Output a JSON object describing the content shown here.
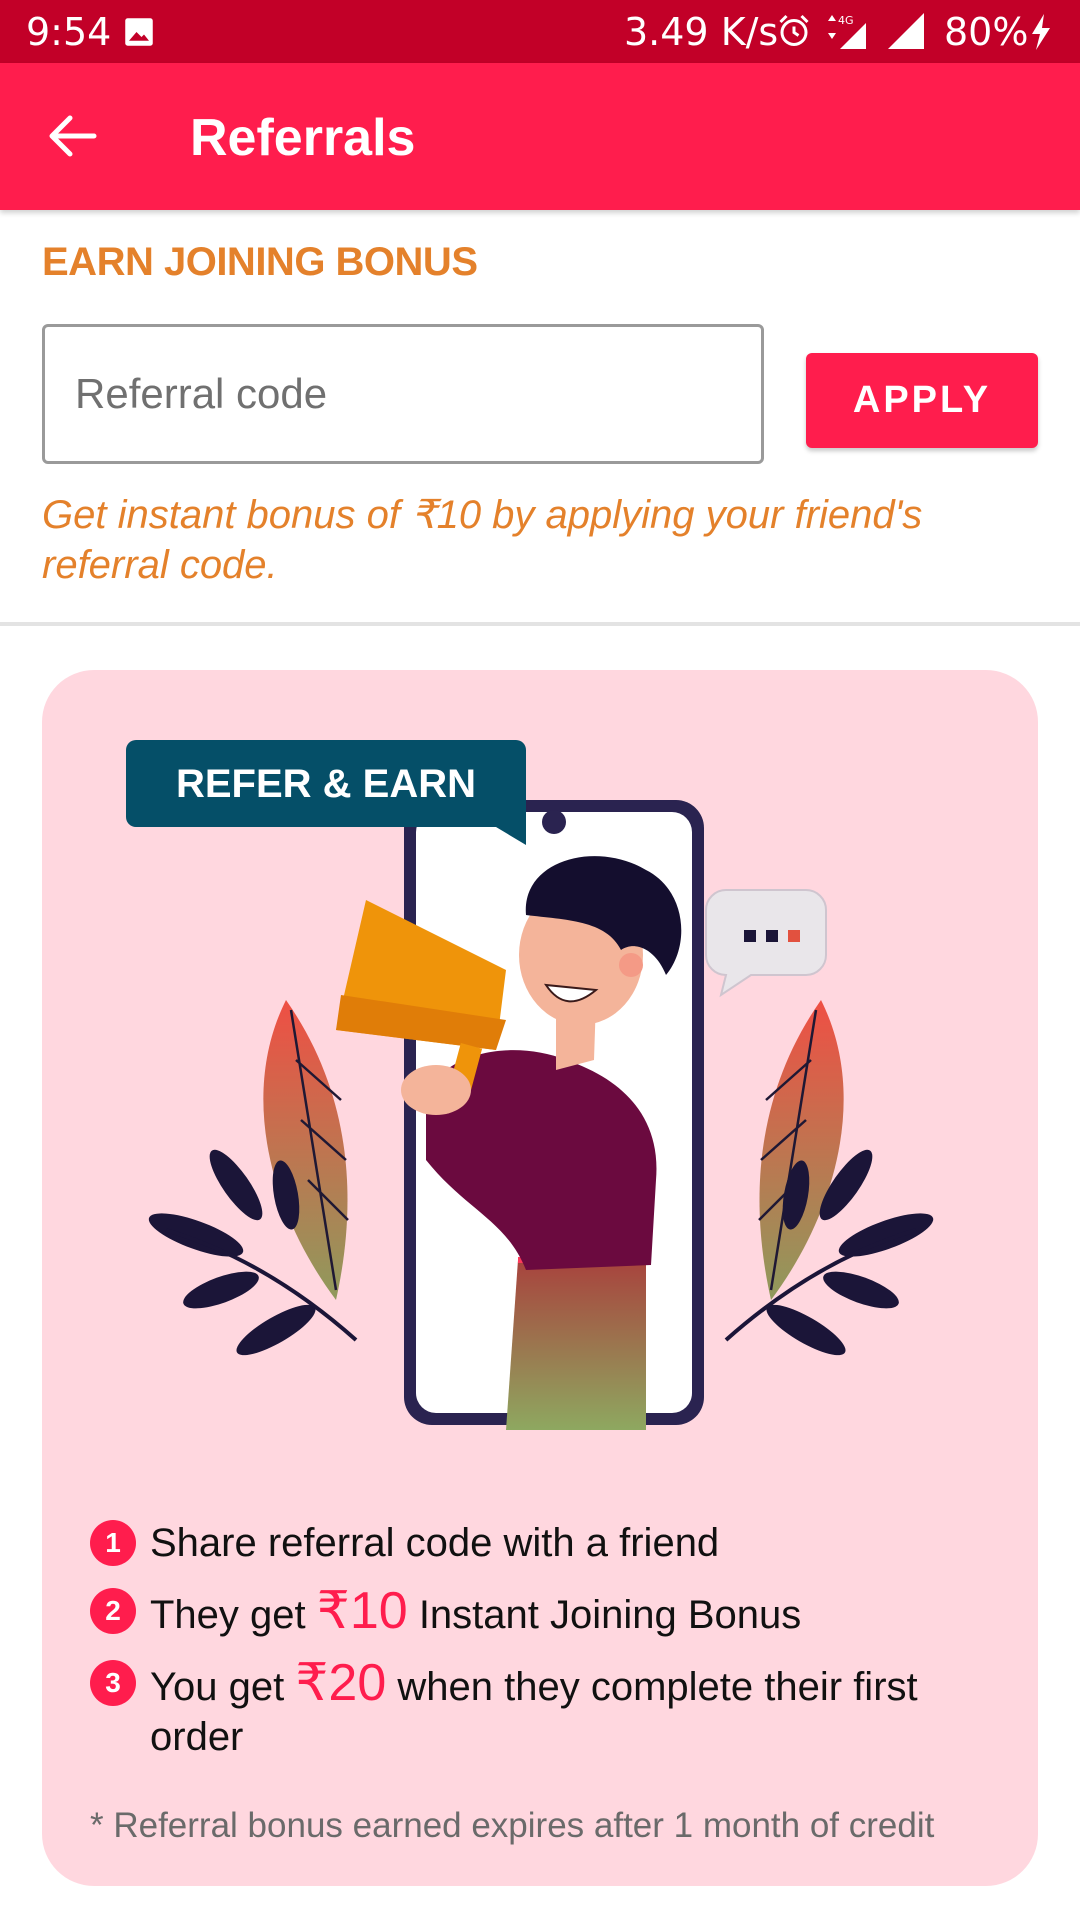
{
  "status_bar": {
    "time": "9:54",
    "net_speed": "3.49 K/s",
    "network_type": "4G",
    "battery": "80%",
    "icons": [
      "image-icon",
      "alarm-icon",
      "data-arrows-icon",
      "signal-icon",
      "charging-bolt-icon"
    ]
  },
  "app_bar": {
    "title": "Referrals",
    "back_icon": "arrow-left-icon",
    "color": "#ff1d4d"
  },
  "bonus_section": {
    "title": "EARN JOINING BONUS",
    "input_value": "",
    "input_placeholder": "Referral code",
    "apply_label": "APPLY",
    "hint": "Get instant bonus of ₹10 by applying your friend's referral code."
  },
  "refer_card": {
    "badge": "REFER & EARN",
    "background": "#ffd7df",
    "steps": [
      {
        "number": "1",
        "text_before": "Share referral code with a friend",
        "amount": "",
        "text_after": ""
      },
      {
        "number": "2",
        "text_before": "They get ",
        "amount": "₹10",
        "text_after": " Instant Joining Bonus"
      },
      {
        "number": "3",
        "text_before": "You get ",
        "amount": "₹20",
        "text_after": " when they complete their first order"
      }
    ],
    "note": "* Referral bonus earned expires after 1 month of credit"
  },
  "colors": {
    "accent": "#ff1d4d",
    "status_bar": "#c20028",
    "orange_text": "#e4812b"
  }
}
